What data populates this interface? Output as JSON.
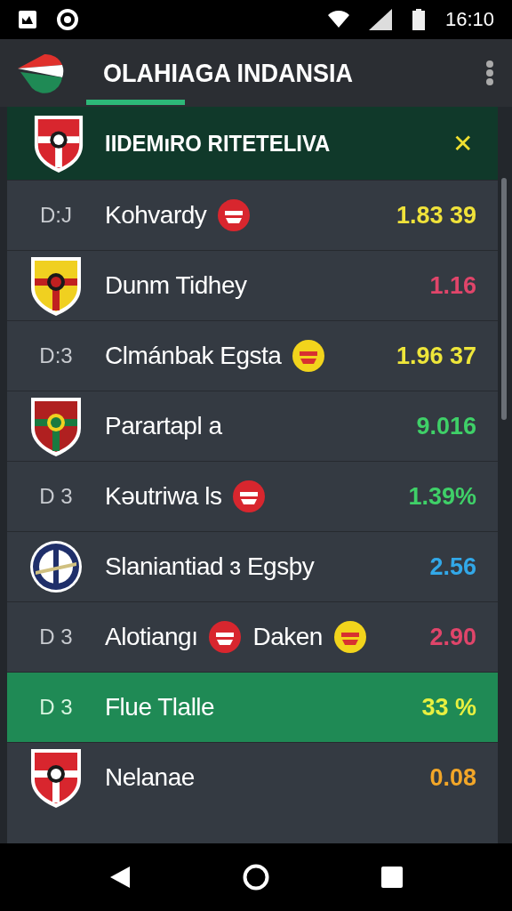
{
  "status_bar": {
    "time": "16:10"
  },
  "app_bar": {
    "title": "OLAHIAGA INDANSIA"
  },
  "header": {
    "title": "IIDEMıRO RITETELIVA",
    "close": "✕"
  },
  "rows": [
    {
      "kind": "code",
      "lead": "D:J",
      "parts": [
        {
          "kind": "text",
          "text": "Kohvardy"
        },
        {
          "kind": "badge"
        }
      ],
      "value": "1.83 39",
      "color": "#f0e23a",
      "selected": false
    },
    {
      "kind": "crest",
      "parts": [
        {
          "kind": "text",
          "text": "Dunm Tidhey"
        }
      ],
      "value": "1.16",
      "color": "#e0456a",
      "selected": false
    },
    {
      "kind": "code",
      "lead": "D:3",
      "parts": [
        {
          "kind": "text",
          "text": "Clmánbak Egsta"
        },
        {
          "kind": "badge"
        }
      ],
      "value": "1.96 37",
      "color": "#eee63a",
      "selected": false
    },
    {
      "kind": "crest",
      "parts": [
        {
          "kind": "text",
          "text": "Parartapl a"
        }
      ],
      "value": "9.016",
      "color": "#3fd068",
      "selected": false
    },
    {
      "kind": "code",
      "lead": "D 3",
      "parts": [
        {
          "kind": "text",
          "text": "Kəutriwa ls"
        },
        {
          "kind": "badge"
        }
      ],
      "value": "1.39%",
      "color": "#3fd068",
      "selected": false
    },
    {
      "kind": "crest",
      "parts": [
        {
          "kind": "text",
          "text": "Slaniantiad ɜ Egsþy"
        }
      ],
      "value": "2.56",
      "color": "#32a8e8",
      "selected": false
    },
    {
      "kind": "code",
      "lead": "D 3",
      "parts": [
        {
          "kind": "text",
          "text": "Alotiangı"
        },
        {
          "kind": "badge"
        },
        {
          "kind": "text",
          "text": "Daken"
        },
        {
          "kind": "badge"
        }
      ],
      "value": "2.90",
      "color": "#e0456a",
      "selected": false
    },
    {
      "kind": "code",
      "lead": "D 3",
      "parts": [
        {
          "kind": "text",
          "text": "Flue Tlalle"
        }
      ],
      "value": "33 %",
      "color": "#e8f040",
      "selected": true
    },
    {
      "kind": "crest",
      "parts": [
        {
          "kind": "text",
          "text": "Nelanae"
        }
      ],
      "value": "0.08",
      "color": "#f2a628",
      "selected": false
    }
  ]
}
